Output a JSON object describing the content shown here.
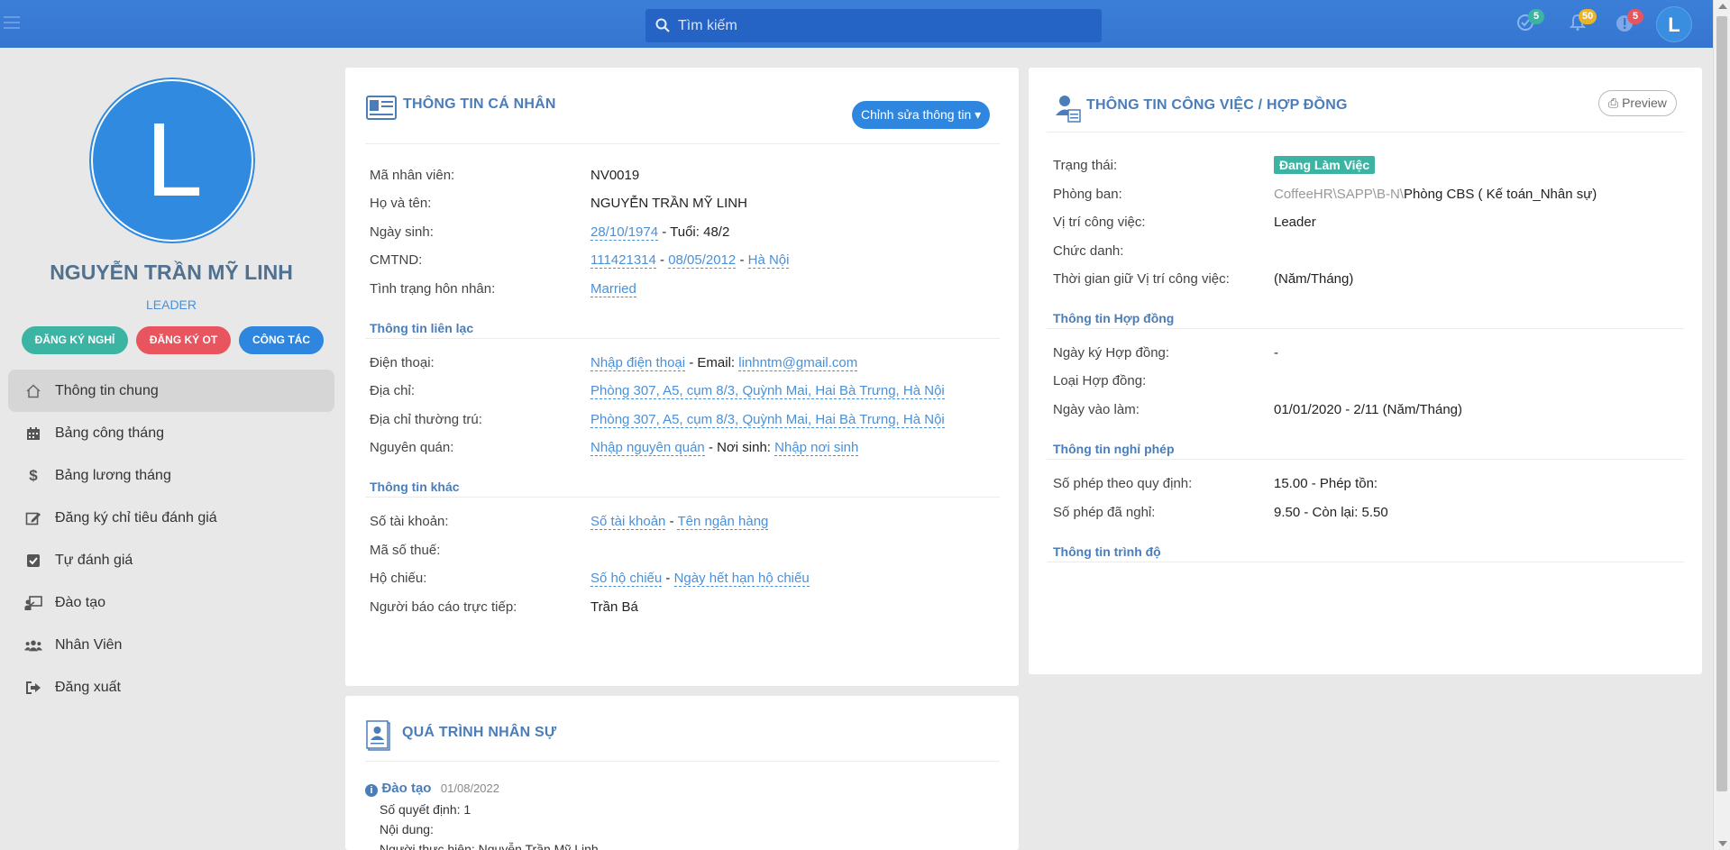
{
  "topbar": {
    "search_placeholder": "Tìm kiếm",
    "badges": {
      "tasks": "5",
      "notifications": "50",
      "alerts": "5"
    },
    "avatar_letter": "L"
  },
  "sidebar": {
    "avatar_letter": "L",
    "name": "NGUYỄN TRẦN MỸ LINH",
    "role": "LEADER",
    "buttons": {
      "leave": "ĐĂNG KÝ NGHỈ",
      "ot": "ĐĂNG KÝ OT",
      "trip": "CÔNG TÁC"
    },
    "nav": [
      {
        "label": "Thông tin chung",
        "icon": "home-icon"
      },
      {
        "label": "Bảng công tháng",
        "icon": "calendar-icon"
      },
      {
        "label": "Bảng lương tháng",
        "icon": "dollar-icon"
      },
      {
        "label": "Đăng ký chỉ tiêu đánh giá",
        "icon": "edit-icon"
      },
      {
        "label": "Tự đánh giá",
        "icon": "check-square-icon"
      },
      {
        "label": "Đào tạo",
        "icon": "chalkboard-icon"
      },
      {
        "label": "Nhân Viên",
        "icon": "users-icon"
      },
      {
        "label": "Đăng xuất",
        "icon": "sign-out-icon"
      }
    ]
  },
  "personal": {
    "title": "THÔNG TIN CÁ NHÂN",
    "edit_label": "Chỉnh sửa thông tin",
    "labels": {
      "emp_id": "Mã nhân viên:",
      "full_name": "Họ và tên:",
      "dob": "Ngày sinh:",
      "id_card": "CMTND:",
      "marital": "Tình trạng hôn nhân:",
      "contact_section": "Thông tin liên lạc",
      "phone": "Điện thoại:",
      "address": "Địa chỉ:",
      "permanent_address": "Địa chỉ thường trú:",
      "hometown": "Nguyên quán:",
      "other_section": "Thông tin khác",
      "bank_account": "Số tài khoản:",
      "tax_code": "Mã số thuế:",
      "passport": "Hộ chiếu:",
      "manager": "Người báo cáo trực tiếp:"
    },
    "values": {
      "emp_id": "NV0019",
      "full_name": "NGUYỄN TRẦN MỸ LINH",
      "dob": "28/10/1974",
      "age_text": " - Tuổi: 48/2",
      "id_number": "111421314",
      "id_date": "08/05/2012",
      "id_place": "Hà Nội",
      "marital": "Married",
      "phone": "Nhập điện thoại",
      "email_label": " - Email: ",
      "email": "linhntm@gmail.com",
      "address": "Phòng 307, A5, cụm 8/3, Quỳnh Mai, Hai Bà Trưng, Hà Nội",
      "permanent_address": "Phòng 307, A5, cụm 8/3, Quỳnh Mai, Hai Bà Trưng, Hà Nội",
      "hometown": "Nhập nguyên quán",
      "birthplace_label": " - Nơi sinh: ",
      "birthplace": "Nhập nơi sinh",
      "bank_account": "Số tài khoản",
      "bank_name": "Tên ngân hàng",
      "passport": "Số hộ chiếu",
      "passport_expiry": "Ngày hết hạn hộ chiếu",
      "manager": "Trần Bá",
      "sep": " - "
    }
  },
  "job": {
    "title": "THÔNG TIN CÔNG VIỆC / HỢP ĐỒNG",
    "preview_label": "Preview",
    "labels": {
      "status": "Trạng thái:",
      "department": "Phòng ban:",
      "position": "Vị trí công việc:",
      "job_title": "Chức danh:",
      "position_duration": "Thời gian giữ Vị trí công việc:",
      "contract_section": "Thông tin Hợp đồng",
      "contract_date": "Ngày ký Hợp đồng:",
      "contract_type": "Loại Hợp đồng:",
      "start_date": "Ngày vào làm:",
      "leave_section": "Thông tin nghỉ phép",
      "leave_quota": "Số phép theo quy định:",
      "leave_used": "Số phép đã nghỉ:",
      "education_section": "Thông tin trình độ"
    },
    "values": {
      "status": "Đang Làm Việc",
      "department_path": "CoffeeHR\\SAPP\\B-N\\",
      "department": "Phòng CBS ( Kế toán_Nhân sự)",
      "position": "Leader",
      "position_duration": "(Năm/Tháng)",
      "contract_date": "-",
      "start_date": "01/01/2020 - 2/11 (Năm/Tháng)",
      "leave_quota": "15.00 - Phép tồn:",
      "leave_used": "9.50 - Còn lại: 5.50"
    }
  },
  "history": {
    "title": "QUÁ TRÌNH NHÂN SỰ",
    "entry_type": "Đào tạo",
    "entry_date": "01/08/2022",
    "decision": "Số quyết định: 1",
    "content": "Nội dung:",
    "performer": "Người thực hiện: Nguyễn Trần Mỹ Linh"
  },
  "colors": {
    "brand": "#3a7bd5",
    "accent": "#2e86de",
    "teal": "#3cb4a4",
    "red": "#e8555f"
  }
}
